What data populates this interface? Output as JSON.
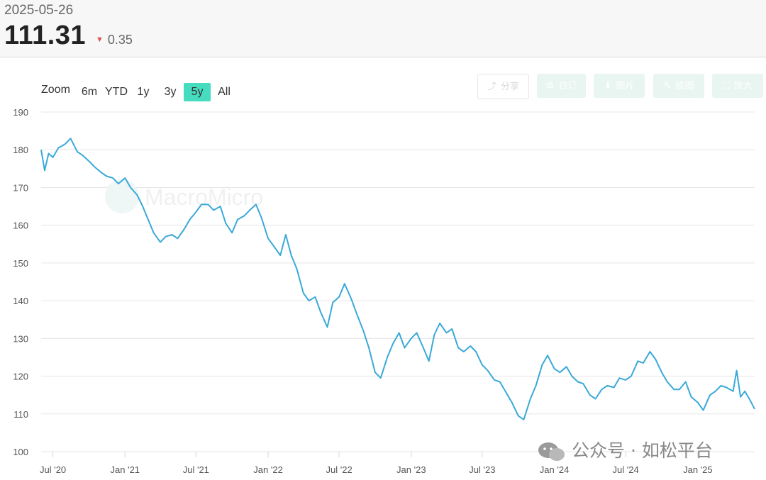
{
  "header": {
    "date": "2025-05-26",
    "price": "111.31",
    "change": "0.35",
    "change_direction": "down",
    "change_color": "#e05050"
  },
  "zoom": {
    "label": "Zoom",
    "buttons": [
      "6m",
      "YTD",
      "1y",
      "3y",
      "5y",
      "All"
    ],
    "active": "5y",
    "active_color": "#45dcc0"
  },
  "toolbar": {
    "share": "分享",
    "custom": "自订",
    "image": "图片",
    "draw": "绘图",
    "enlarge": "放大"
  },
  "watermark": "MacroMicro",
  "wechat_label": "公众号 · 如松平台",
  "chart_data": {
    "type": "line",
    "series": [
      {
        "color": "#3aa9d8",
        "points": [
          [
            "2020-06-01",
            180.0
          ],
          [
            "2020-06-10",
            174.5
          ],
          [
            "2020-06-20",
            179.0
          ],
          [
            "2020-07-01",
            178.0
          ],
          [
            "2020-07-15",
            180.5
          ],
          [
            "2020-08-01",
            181.5
          ],
          [
            "2020-08-15",
            183.0
          ],
          [
            "2020-09-01",
            179.5
          ],
          [
            "2020-09-15",
            178.5
          ],
          [
            "2020-10-01",
            177.0
          ],
          [
            "2020-10-15",
            175.5
          ],
          [
            "2020-11-01",
            174.0
          ],
          [
            "2020-11-15",
            173.0
          ],
          [
            "2020-12-01",
            172.5
          ],
          [
            "2020-12-15",
            171.0
          ],
          [
            "2021-01-01",
            172.5
          ],
          [
            "2021-01-15",
            170.0
          ],
          [
            "2021-02-01",
            168.0
          ],
          [
            "2021-02-15",
            165.0
          ],
          [
            "2021-03-01",
            161.5
          ],
          [
            "2021-03-15",
            158.0
          ],
          [
            "2021-04-01",
            155.5
          ],
          [
            "2021-04-15",
            157.0
          ],
          [
            "2021-05-01",
            157.5
          ],
          [
            "2021-05-15",
            156.5
          ],
          [
            "2021-06-01",
            159.0
          ],
          [
            "2021-06-15",
            161.5
          ],
          [
            "2021-07-01",
            163.5
          ],
          [
            "2021-07-15",
            165.5
          ],
          [
            "2021-08-01",
            165.5
          ],
          [
            "2021-08-15",
            164.0
          ],
          [
            "2021-09-01",
            165.0
          ],
          [
            "2021-09-15",
            160.5
          ],
          [
            "2021-10-01",
            158.0
          ],
          [
            "2021-10-15",
            161.5
          ],
          [
            "2021-11-01",
            162.5
          ],
          [
            "2021-11-15",
            164.0
          ],
          [
            "2021-12-01",
            165.5
          ],
          [
            "2021-12-15",
            162.0
          ],
          [
            "2022-01-01",
            156.5
          ],
          [
            "2022-01-15",
            154.5
          ],
          [
            "2022-02-01",
            152.0
          ],
          [
            "2022-02-15",
            157.5
          ],
          [
            "2022-03-01",
            152.0
          ],
          [
            "2022-03-15",
            148.5
          ],
          [
            "2022-04-01",
            142.0
          ],
          [
            "2022-04-15",
            140.0
          ],
          [
            "2022-05-01",
            141.0
          ],
          [
            "2022-05-15",
            137.0
          ],
          [
            "2022-06-01",
            133.0
          ],
          [
            "2022-06-15",
            139.5
          ],
          [
            "2022-07-01",
            141.0
          ],
          [
            "2022-07-15",
            144.5
          ],
          [
            "2022-08-01",
            140.5
          ],
          [
            "2022-08-15",
            136.5
          ],
          [
            "2022-09-01",
            132.0
          ],
          [
            "2022-09-15",
            127.5
          ],
          [
            "2022-10-01",
            121.0
          ],
          [
            "2022-10-15",
            119.5
          ],
          [
            "2022-11-01",
            125.0
          ],
          [
            "2022-11-15",
            128.5
          ],
          [
            "2022-12-01",
            131.5
          ],
          [
            "2022-12-15",
            127.5
          ],
          [
            "2023-01-01",
            130.0
          ],
          [
            "2023-01-15",
            131.5
          ],
          [
            "2023-02-01",
            127.5
          ],
          [
            "2023-02-15",
            124.0
          ],
          [
            "2023-03-01",
            131.0
          ],
          [
            "2023-03-15",
            134.0
          ],
          [
            "2023-04-01",
            131.5
          ],
          [
            "2023-04-15",
            132.5
          ],
          [
            "2023-05-01",
            127.5
          ],
          [
            "2023-05-15",
            126.5
          ],
          [
            "2023-06-01",
            128.0
          ],
          [
            "2023-06-15",
            126.5
          ],
          [
            "2023-07-01",
            123.0
          ],
          [
            "2023-07-15",
            121.5
          ],
          [
            "2023-08-01",
            119.0
          ],
          [
            "2023-08-15",
            118.5
          ],
          [
            "2023-09-01",
            115.5
          ],
          [
            "2023-09-15",
            113.0
          ],
          [
            "2023-10-01",
            109.5
          ],
          [
            "2023-10-15",
            108.5
          ],
          [
            "2023-11-01",
            114.0
          ],
          [
            "2023-11-15",
            117.5
          ],
          [
            "2023-12-01",
            123.0
          ],
          [
            "2023-12-15",
            125.5
          ],
          [
            "2024-01-01",
            122.0
          ],
          [
            "2024-01-15",
            121.0
          ],
          [
            "2024-02-01",
            122.5
          ],
          [
            "2024-02-15",
            120.0
          ],
          [
            "2024-03-01",
            118.5
          ],
          [
            "2024-03-15",
            118.0
          ],
          [
            "2024-04-01",
            115.0
          ],
          [
            "2024-04-15",
            114.0
          ],
          [
            "2024-05-01",
            116.5
          ],
          [
            "2024-05-15",
            117.5
          ],
          [
            "2024-06-01",
            117.0
          ],
          [
            "2024-06-15",
            119.5
          ],
          [
            "2024-07-01",
            119.0
          ],
          [
            "2024-07-15",
            120.0
          ],
          [
            "2024-08-01",
            124.0
          ],
          [
            "2024-08-15",
            123.5
          ],
          [
            "2024-09-01",
            126.5
          ],
          [
            "2024-09-15",
            124.5
          ],
          [
            "2024-10-01",
            121.0
          ],
          [
            "2024-10-15",
            118.5
          ],
          [
            "2024-11-01",
            116.5
          ],
          [
            "2024-11-15",
            116.5
          ],
          [
            "2024-12-01",
            118.5
          ],
          [
            "2024-12-15",
            114.5
          ],
          [
            "2025-01-01",
            113.0
          ],
          [
            "2025-01-15",
            111.0
          ],
          [
            "2025-02-01",
            115.0
          ],
          [
            "2025-02-15",
            116.0
          ],
          [
            "2025-03-01",
            117.5
          ],
          [
            "2025-03-15",
            117.0
          ],
          [
            "2025-04-01",
            116.0
          ],
          [
            "2025-04-10",
            121.5
          ],
          [
            "2025-04-20",
            114.5
          ],
          [
            "2025-05-01",
            116.0
          ],
          [
            "2025-05-15",
            113.5
          ],
          [
            "2025-05-26",
            111.3
          ]
        ]
      }
    ],
    "ylim": [
      100,
      190
    ],
    "yticks": [
      "190",
      "180",
      "170",
      "160",
      "150",
      "140",
      "130",
      "120",
      "110",
      "100"
    ],
    "xticks": [
      {
        "label": "Jul '20",
        "date": "2020-07-01"
      },
      {
        "label": "Jan '21",
        "date": "2021-01-01"
      },
      {
        "label": "Jul '21",
        "date": "2021-07-01"
      },
      {
        "label": "Jan '22",
        "date": "2022-01-01"
      },
      {
        "label": "Jul '22",
        "date": "2022-07-01"
      },
      {
        "label": "Jan '23",
        "date": "2023-01-01"
      },
      {
        "label": "Jul '23",
        "date": "2023-07-01"
      },
      {
        "label": "Jan '24",
        "date": "2024-01-01"
      },
      {
        "label": "Jul '24",
        "date": "2024-07-01"
      },
      {
        "label": "Jan '25",
        "date": "2025-01-01"
      }
    ],
    "grid": true,
    "legend": false
  }
}
